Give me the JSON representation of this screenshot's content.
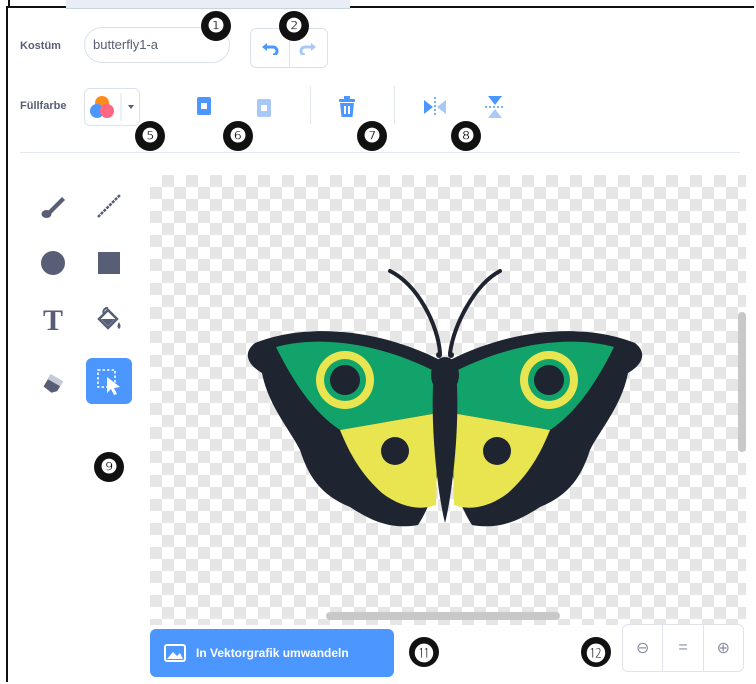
{
  "header": {
    "costume_label": "Kostüm",
    "costume_name": "butterfly1-a",
    "fill_label": "Füllfarbe"
  },
  "toolbar": {
    "undo_icon": "undo-icon",
    "redo_icon": "redo-icon",
    "copy_icon": "copy-icon",
    "paste_icon": "paste-icon",
    "delete_icon": "trash-icon",
    "flip_horizontal_icon": "flip-horizontal-icon",
    "flip_vertical_icon": "flip-vertical-icon"
  },
  "tools": [
    "brush-icon",
    "line-icon",
    "circle-icon",
    "rectangle-icon",
    "text-icon",
    "fill-icon",
    "eraser-icon",
    "select-icon"
  ],
  "tool_text_glyph": "T",
  "canvas": {
    "wing_green": "#12a36a",
    "wing_yellow": "#e8e550",
    "body_dark": "#1e2430"
  },
  "convert_button": {
    "label": "In Vektorgrafik umwandeln"
  },
  "zoom": {
    "zoom_out": "⊖",
    "reset": "=",
    "zoom_in": "⊕"
  },
  "annotations": [
    "❶",
    "❷",
    "❺",
    "❻",
    "❼",
    "❽",
    "❾",
    "⓫",
    "⓬"
  ],
  "colors": {
    "accent": "#4c97ff",
    "text": "#575e75"
  }
}
